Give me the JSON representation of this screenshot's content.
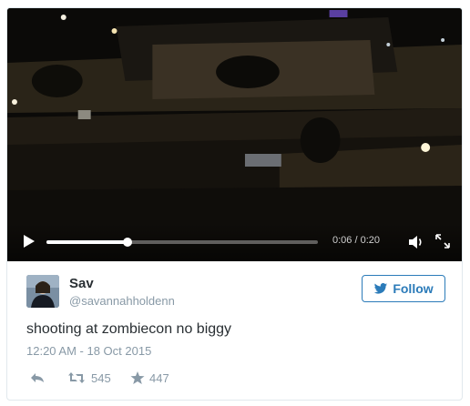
{
  "video": {
    "current_time": "0:06",
    "duration": "0:20",
    "time_display": "0:06 / 0:20",
    "progress_fraction": 0.3
  },
  "author": {
    "name": "Sav",
    "handle": "@savannahholdenn"
  },
  "follow_button": {
    "label": "Follow"
  },
  "tweet": {
    "text": "shooting at zombiecon no biggy",
    "timestamp": "12:20 AM - 18 Oct 2015",
    "retweet_count": "545",
    "like_count": "447"
  },
  "colors": {
    "twitter_blue": "#2b7bb9",
    "muted_text": "#8899a6",
    "body_text": "#292f33"
  },
  "icons": [
    "play-icon",
    "volume-icon",
    "fullscreen-icon",
    "twitter-bird-icon",
    "reply-icon",
    "retweet-icon",
    "star-icon"
  ]
}
